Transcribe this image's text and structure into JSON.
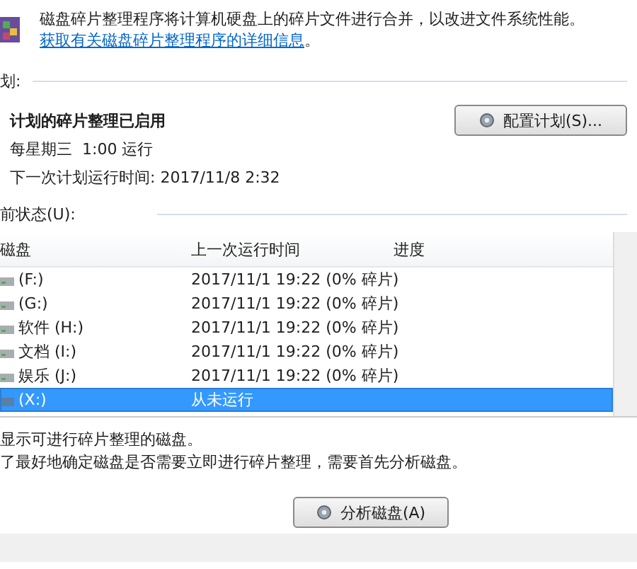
{
  "intro": {
    "text": "磁盘碎片整理程序将计算机硬盘上的碎片文件进行合并，以改进文件系统性能。",
    "link": "获取有关磁盘碎片整理程序的详细信息",
    "end": "。"
  },
  "schedule": {
    "heading": "划:",
    "status": "计划的碎片整理已启用",
    "when": "每星期三  1:00 运行",
    "next": "下一次计划运行时间: 2017/11/8 2:32",
    "button": "配置计划(S)..."
  },
  "current_status": {
    "heading": "前状态(U):",
    "table": {
      "columns": [
        "磁盘",
        "上一次运行时间",
        "进度"
      ],
      "rows": [
        {
          "disk": "(F:)",
          "last_run": "2017/11/1 19:22 (0% 碎片)",
          "kind": "drive",
          "selected": false
        },
        {
          "disk": "(G:)",
          "last_run": "2017/11/1 19:22 (0% 碎片)",
          "kind": "drive",
          "selected": false
        },
        {
          "disk": "软件 (H:)",
          "last_run": "2017/11/1 19:22 (0% 碎片)",
          "kind": "drive",
          "selected": false
        },
        {
          "disk": "文档 (I:)",
          "last_run": "2017/11/1 19:22 (0% 碎片)",
          "kind": "drive",
          "selected": false
        },
        {
          "disk": "娱乐 (J:)",
          "last_run": "2017/11/1 19:22 (0% 碎片)",
          "kind": "drive",
          "selected": false
        },
        {
          "disk": "(X:)",
          "last_run": "从未运行",
          "kind": "removable",
          "selected": true
        }
      ]
    }
  },
  "notes": [
    "显示可进行碎片整理的磁盘。",
    "了最好地确定磁盘是否需要立即进行碎片整理，需要首先分析磁盘。"
  ],
  "buttons": {
    "analyze": "分析磁盘(A)"
  }
}
